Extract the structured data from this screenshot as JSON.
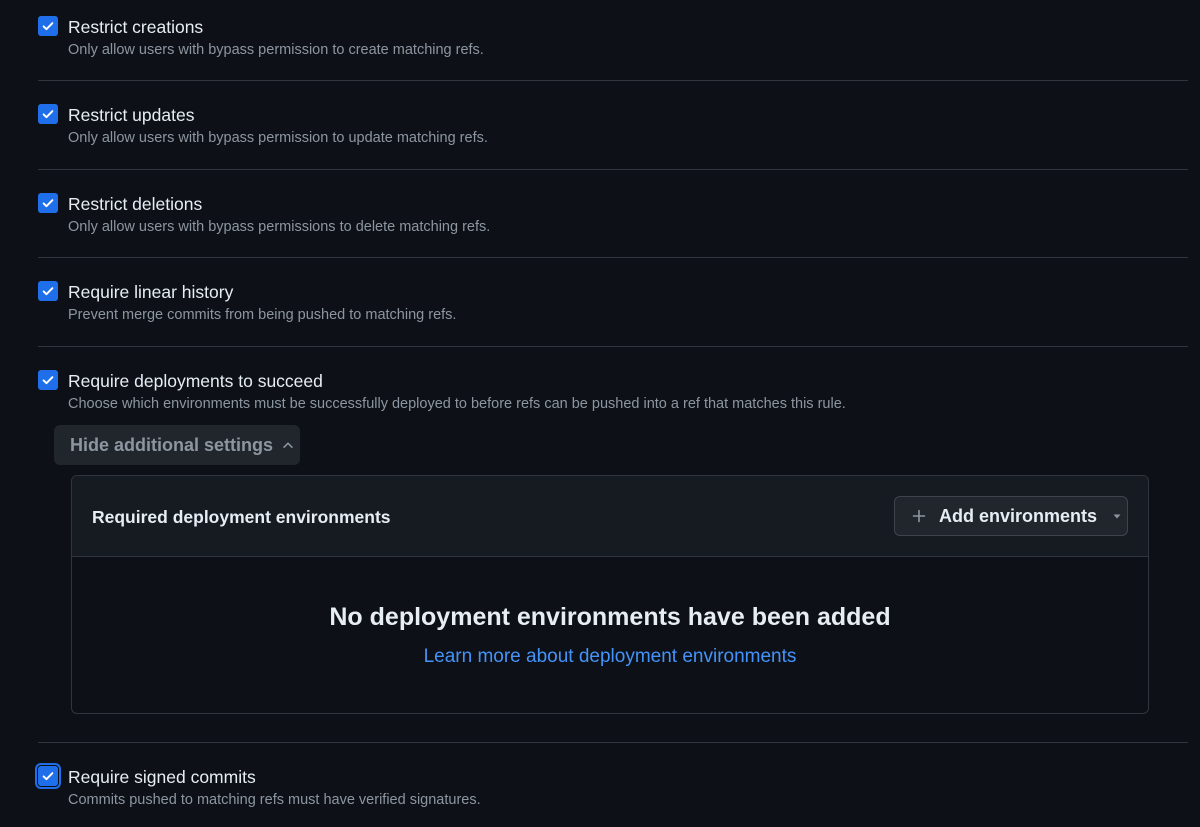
{
  "rules": [
    {
      "title": "Restrict creations",
      "desc": "Only allow users with bypass permission to create matching refs.",
      "checked": true
    },
    {
      "title": "Restrict updates",
      "desc": "Only allow users with bypass permission to update matching refs.",
      "checked": true
    },
    {
      "title": "Restrict deletions",
      "desc": "Only allow users with bypass permissions to delete matching refs.",
      "checked": true
    },
    {
      "title": "Require linear history",
      "desc": "Prevent merge commits from being pushed to matching refs.",
      "checked": true
    },
    {
      "title": "Require deployments to succeed",
      "desc": "Choose which environments must be successfully deployed to before refs can be pushed into a ref that matches this rule.",
      "checked": true
    },
    {
      "title": "Require signed commits",
      "desc": "Commits pushed to matching refs must have verified signatures.",
      "checked": true
    }
  ],
  "deployments": {
    "hide_label": "Hide additional settings",
    "box_title": "Required deployment environments",
    "add_label": "Add environments",
    "empty_title": "No deployment environments have been added",
    "empty_link": "Learn more about deployment environments"
  },
  "icons": {
    "check": "check-icon",
    "chevron_up": "chevron-up-icon",
    "plus": "plus-icon",
    "caret_down": "caret-down-icon"
  },
  "colors": {
    "accent": "#1f6feb",
    "link": "#4493f8",
    "background": "#0d1117"
  }
}
